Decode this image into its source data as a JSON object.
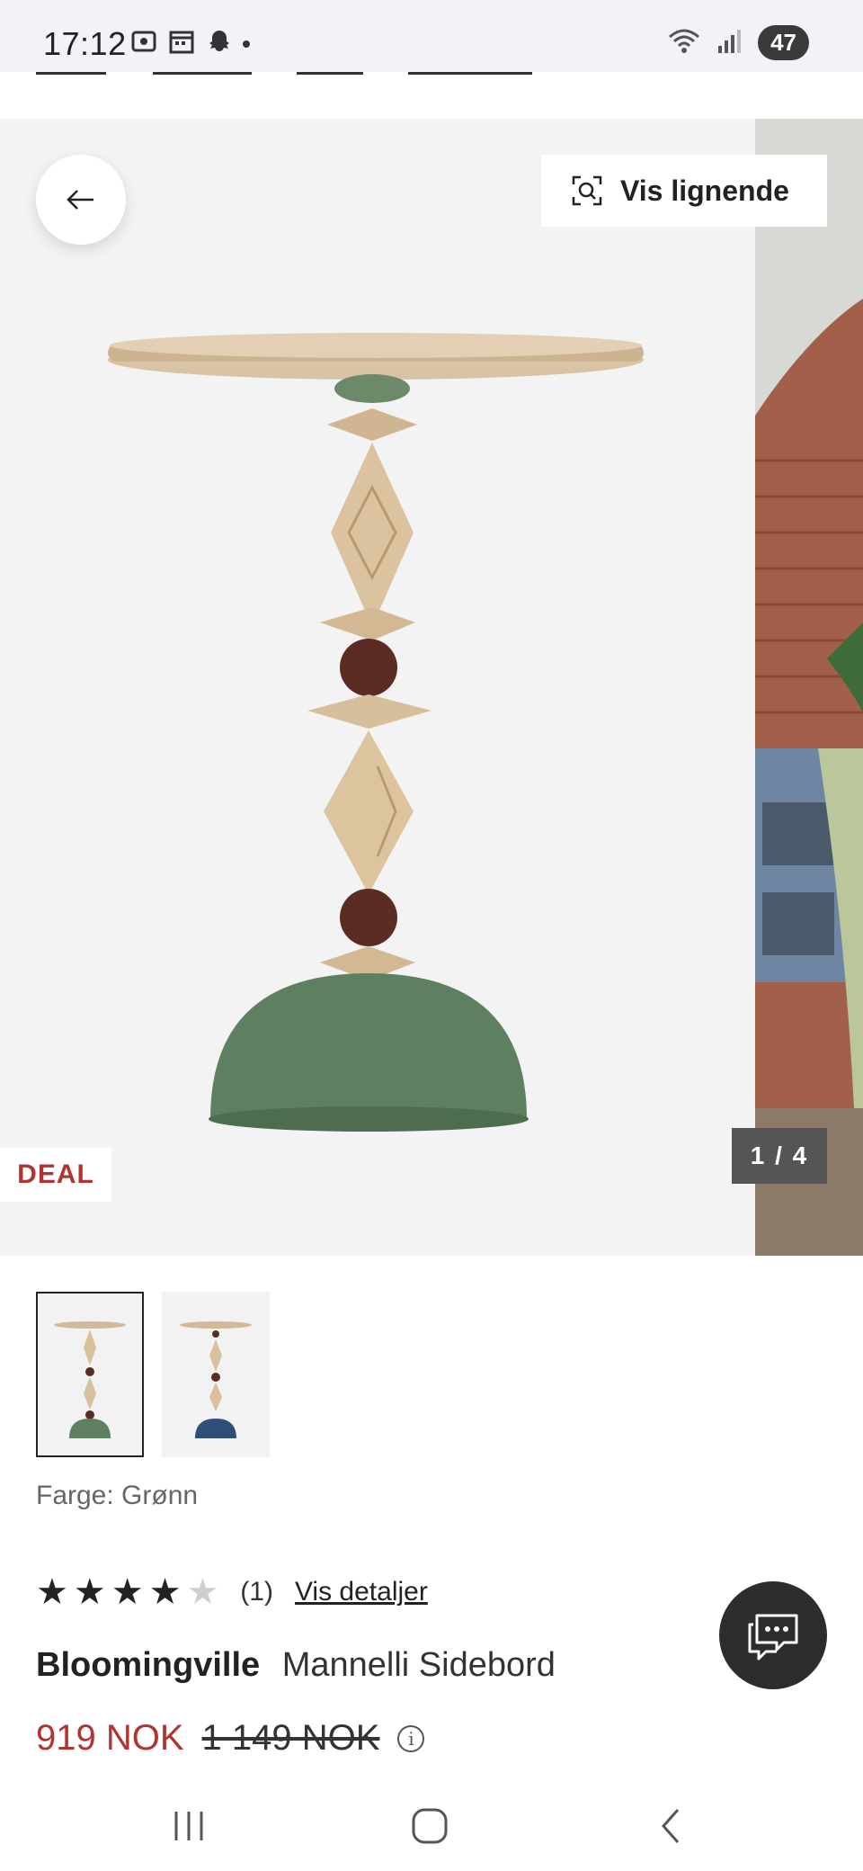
{
  "status_bar": {
    "time": "17:12",
    "battery": "47",
    "left_icons": [
      "screenshot-icon",
      "calendar-icon",
      "snapchat-icon",
      "notification-dot"
    ],
    "right_icons": [
      "wifi-icon",
      "signal-icon"
    ]
  },
  "gallery": {
    "similar_label": "Vis lignende",
    "deal_label": "DEAL",
    "counter": "1 / 4",
    "colors": {
      "deal_red": "#b03530",
      "table_green": "#5d8060",
      "table_blue": "#2f4f7a",
      "wood": "#d9c3a5"
    }
  },
  "thumbnails": [
    {
      "variant": "green",
      "selected": true
    },
    {
      "variant": "blue",
      "selected": false
    }
  ],
  "product": {
    "color_label": "Farge: Grønn",
    "rating_value": 4,
    "rating_max": 5,
    "rating_count": "(1)",
    "details_link": "Vis detaljer",
    "brand": "Bloomingville",
    "name": "Mannelli Sidebord",
    "price_now": "919 NOK",
    "price_old": "1 149 NOK"
  }
}
